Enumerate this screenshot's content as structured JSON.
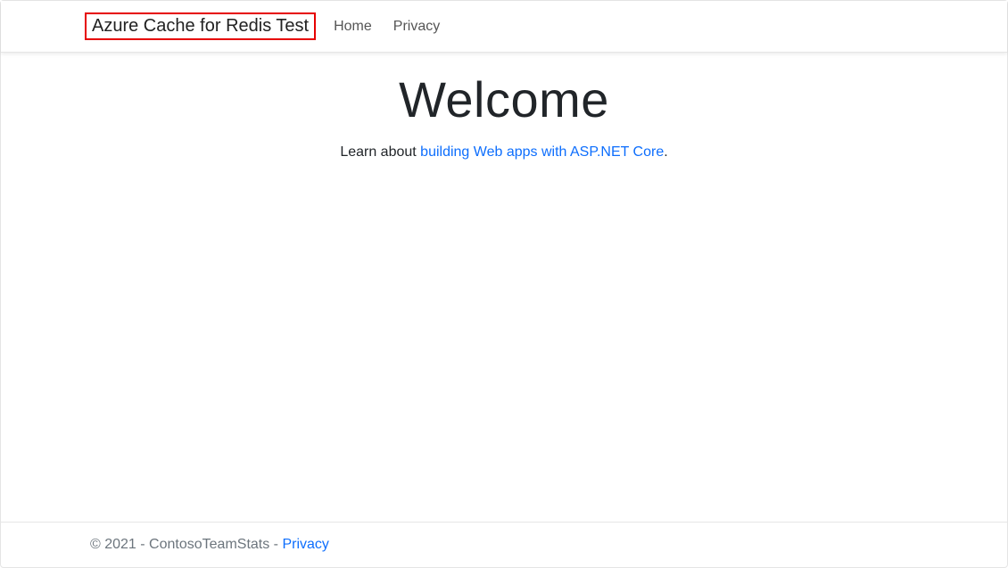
{
  "header": {
    "brand": "Azure Cache for Redis Test",
    "nav": [
      {
        "label": "Home"
      },
      {
        "label": "Privacy"
      }
    ]
  },
  "main": {
    "heading": "Welcome",
    "lead_prefix": "Learn about ",
    "lead_link": "building Web apps with ASP.NET Core",
    "lead_suffix": "."
  },
  "footer": {
    "copyright": "© 2021 - ContosoTeamStats - ",
    "privacy_label": "Privacy"
  }
}
